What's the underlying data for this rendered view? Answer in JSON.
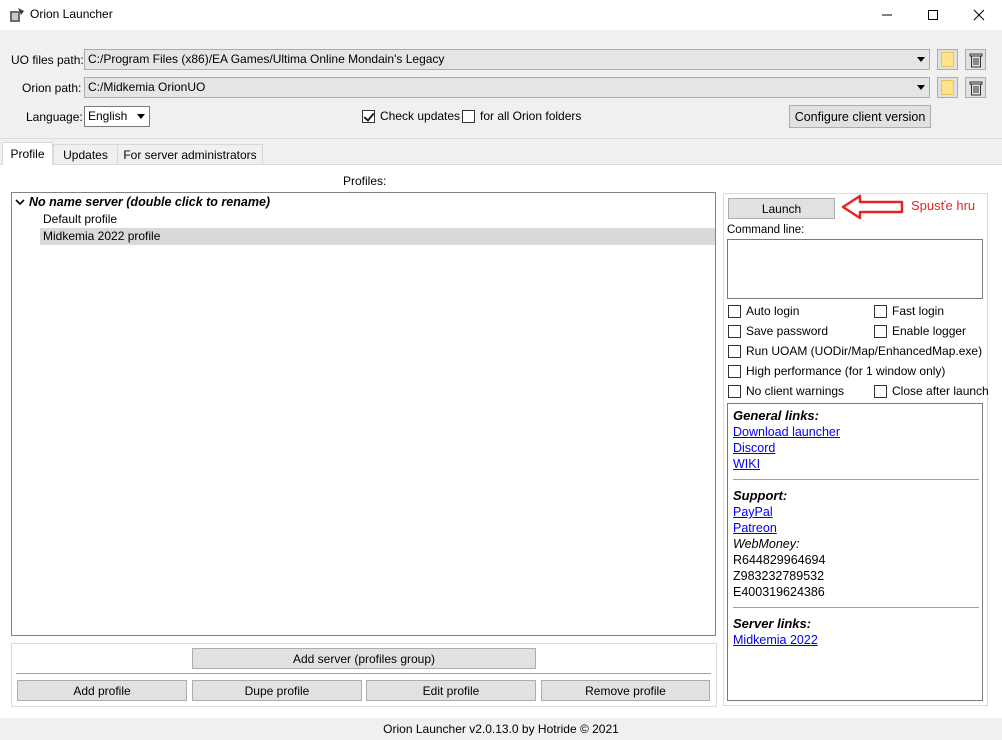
{
  "window": {
    "title": "Orion Launcher"
  },
  "paths": {
    "uo_label": "UO files path:",
    "uo_value": "C:/Program Files (x86)/EA Games/Ultima Online Mondain's Legacy",
    "orion_label": "Orion path:",
    "orion_value": "C:/Midkemia OrionUO"
  },
  "language": {
    "label": "Language:",
    "value": "English"
  },
  "options_top": {
    "check_updates": "Check updates",
    "for_all_folders": "for all Orion folders",
    "configure_button": "Configure client version"
  },
  "tabs": [
    {
      "label": "Profile"
    },
    {
      "label": "Updates"
    },
    {
      "label": "For server administrators"
    }
  ],
  "profiles": {
    "header": "Profiles:",
    "server_name": "No name server (double click to rename)",
    "items": [
      "Default profile",
      "Midkemia 2022 profile"
    ]
  },
  "actions": {
    "add_server": "Add server (profiles group)",
    "add_profile": "Add profile",
    "dupe_profile": "Dupe profile",
    "edit_profile": "Edit profile",
    "remove_profile": "Remove profile"
  },
  "launch": {
    "button": "Launch",
    "annotation": "Spusťe hru",
    "command_line_label": "Command line:"
  },
  "options": {
    "auto_login": "Auto login",
    "fast_login": "Fast login",
    "save_password": "Save password",
    "enable_logger": "Enable logger",
    "run_uoam": "Run UOAM (UODir/Map/EnhancedMap.exe)",
    "high_performance": "High performance (for 1 window only)",
    "no_client_warnings": "No client warnings",
    "close_after_launch": "Close after launch"
  },
  "links": {
    "general_header": "General links:",
    "download_launcher": "Download launcher",
    "discord": "Discord",
    "wiki": "WIKI",
    "support_header": "Support:",
    "paypal": "PayPal",
    "patreon": "Patreon",
    "webmoney_label": "WebMoney:",
    "webmoney_ids": [
      "R644829964694",
      "Z983232789532",
      "E400319624386"
    ],
    "server_header": "Server links:",
    "midkemia": "Midkemia 2022"
  },
  "status": "Orion Launcher v2.0.13.0 by Hotride © 2021",
  "colors": {
    "link": "#0000ee",
    "annotation": "#e32525"
  }
}
